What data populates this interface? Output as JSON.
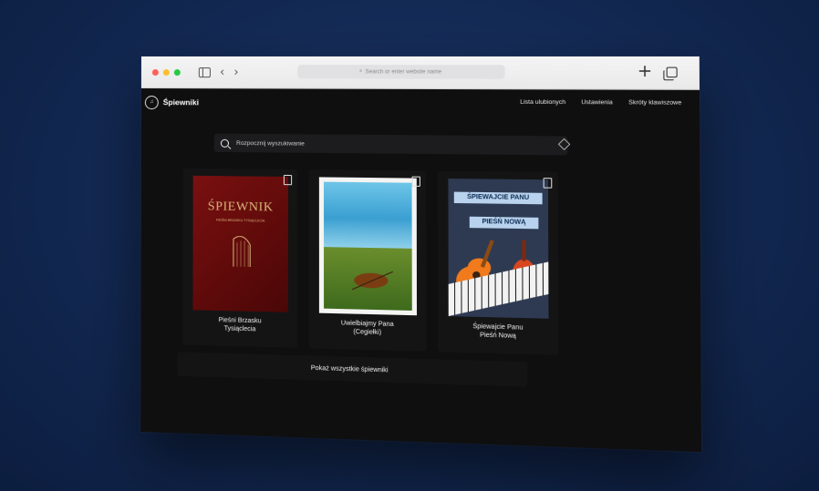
{
  "browser": {
    "url_placeholder": "Search or enter website name"
  },
  "app": {
    "logo_text": "Śpiewniki",
    "nav": [
      "Lista ulubionych",
      "Ustawienia",
      "Skróty klawiszowe"
    ]
  },
  "search": {
    "placeholder": "Rozpocznij wyszukiwanie"
  },
  "books": [
    {
      "title_line1": "Pieśni Brzasku",
      "title_line2": "Tysiąclecia",
      "cover_text": "ŚPIEWNIK",
      "cover_subtext": "PIEŚNI BRZASKU TYSIĄCLECIA"
    },
    {
      "title_line1": "Uwielbiajmy Pana",
      "title_line2": "(Cegiełki)"
    },
    {
      "title_line1": "Śpiewajcie Panu",
      "title_line2": "Pieśń Nową",
      "cover_banner1": "ŚPIEWAJCIE PANU",
      "cover_banner2": "PIEŚŃ NOWĄ"
    }
  ],
  "show_all_label": "Pokaż wszystkie śpiewniki",
  "colors": {
    "background": "#132a55",
    "app_bg": "#0f0f10",
    "card_bg": "#141415"
  }
}
